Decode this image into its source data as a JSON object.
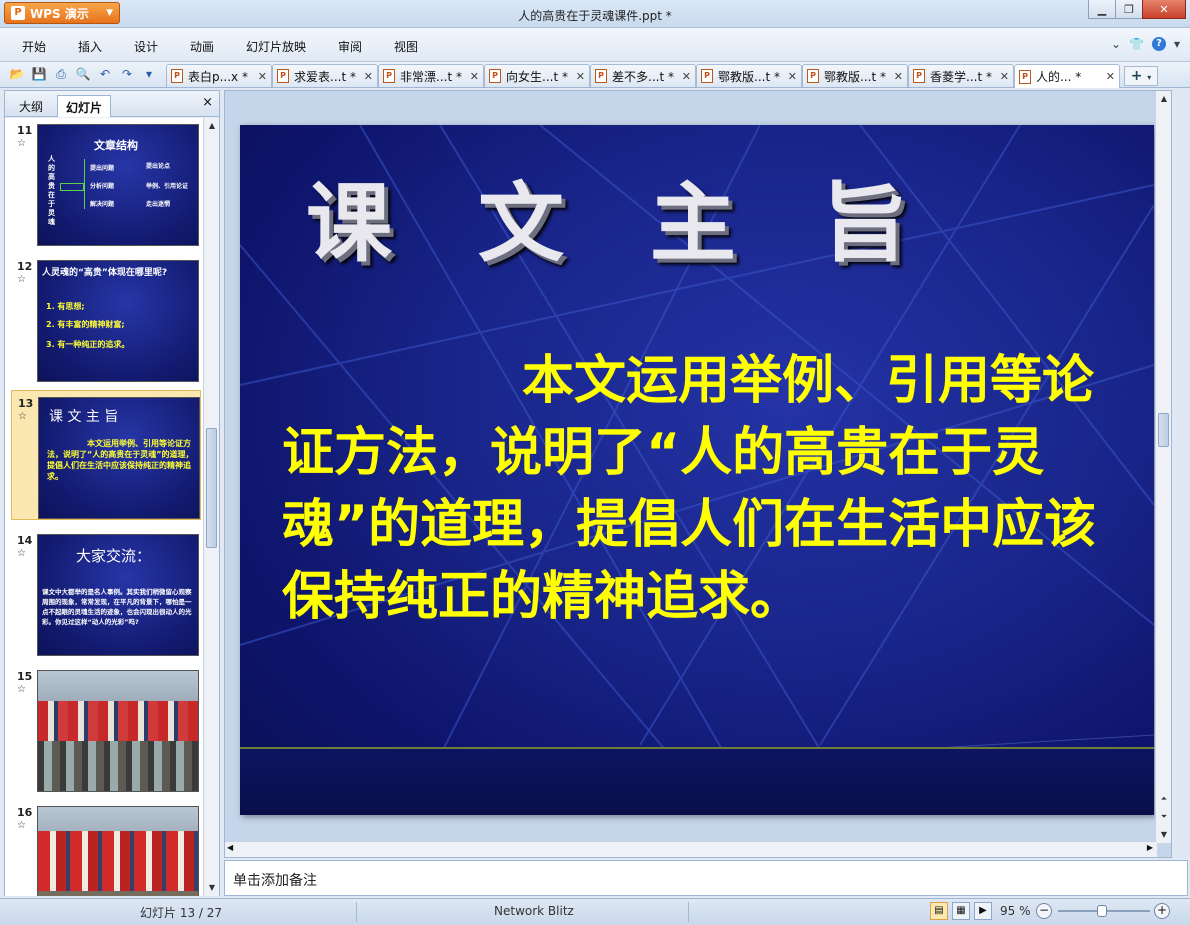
{
  "app": {
    "menu_button": "WPS 演示",
    "window_title": "人的高贵在于灵魂课件.ppt *"
  },
  "menu": {
    "items": [
      "开始",
      "插入",
      "设计",
      "动画",
      "幻灯片放映",
      "审阅",
      "视图"
    ]
  },
  "tabs": [
    {
      "label": "表白p...x *",
      "active": false
    },
    {
      "label": "求爱表...t *",
      "active": false
    },
    {
      "label": "非常漂...t *",
      "active": false
    },
    {
      "label": "向女生...t *",
      "active": false
    },
    {
      "label": "差不多...t *",
      "active": false
    },
    {
      "label": "鄂教版...t *",
      "active": false
    },
    {
      "label": "鄂教版...t *",
      "active": false
    },
    {
      "label": "香菱学...t *",
      "active": false
    },
    {
      "label": "人的... *",
      "active": true
    }
  ],
  "left_panel": {
    "tab_outline": "大纲",
    "tab_slides": "幻灯片",
    "close": "×"
  },
  "thumbnails": [
    {
      "num": "11",
      "title": "文章结构",
      "vertical": "人的高贵在于灵魂",
      "left": [
        "提出问题",
        "分析问题",
        "解决问题"
      ],
      "right": [
        "提出论点",
        "举例、引用论证",
        "走出迷惘"
      ]
    },
    {
      "num": "12",
      "title": "人灵魂的“高贵”体现在哪里呢?",
      "items": [
        "1. 有思想;",
        "2. 有丰富的精神财富;",
        "3. 有一种纯正的追求。"
      ]
    },
    {
      "num": "13",
      "title": "课 文 主 旨",
      "text": "本文运用举例、引用等论证方法，说明了“人的高贵在于灵魂”的道理，提倡人们在生活中应该保持纯正的精神追求。"
    },
    {
      "num": "14",
      "title": "大家交流：",
      "text": "课文中大都举的是名人事例。其实我们稍微留心观察周围的现象，常常发现，在平凡的背景下，哪怕是一点不起眼的灵魂生活的迹象，也会闪现出很动人的光彩。你见过这样“动人的光彩”吗?"
    },
    {
      "num": "15"
    },
    {
      "num": "16"
    }
  ],
  "slide": {
    "title": "课 文 主 旨",
    "body": "本文运用举例、引用等论证方法，说明了“人的高贵在于灵魂”的道理，提倡人们在生活中应该保持纯正的精神追求。"
  },
  "notes_placeholder": "单击添加备注",
  "status": {
    "slide_counter": "幻灯片 13 / 27",
    "theme": "Network Blitz",
    "zoom": "95 %",
    "zoom_fraction": 0.95
  }
}
